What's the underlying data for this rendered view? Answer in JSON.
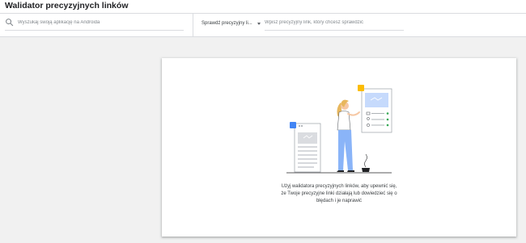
{
  "header": {
    "title": "Walidator precyzyjnych linków"
  },
  "toolbar": {
    "search": {
      "placeholder": "Wyszukaj swoją aplikację na Androida",
      "value": ""
    },
    "dropdown": {
      "selected": "Sprawdź precyzyjny li..."
    },
    "link_input": {
      "placeholder": "Wpisz precyzyjny link, który chcesz sprawdzić",
      "value": ""
    }
  },
  "empty_state": {
    "message_lines": [
      "Użyj walidatora precyzyjnych linków, aby upewnić się,",
      "że Twoje precyzyjne linki działają lub dowiedzieć się o",
      "błędach i je naprawić"
    ]
  },
  "colors": {
    "accent_blue": "#4285f4",
    "accent_yellow": "#fbbc04",
    "accent_green": "#34a853",
    "light_blue": "#c6dafc",
    "hair": "#e8b75d"
  },
  "icons": {
    "search": "search-icon",
    "dropdown": "caret-down-icon"
  }
}
